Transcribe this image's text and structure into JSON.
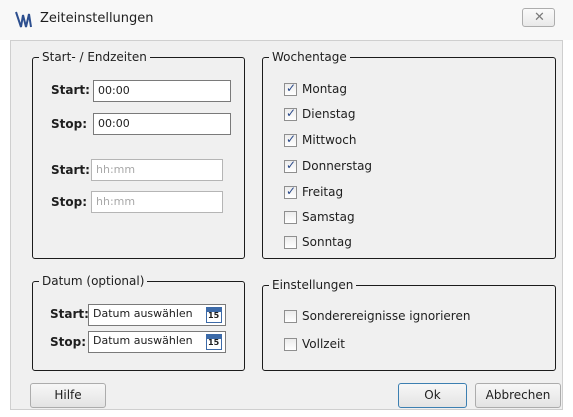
{
  "window": {
    "title": "Zeiteinstellungen",
    "close_glyph": "✕"
  },
  "times": {
    "legend": "Start- / Endzeiten",
    "rows": [
      {
        "label": "Start:",
        "value": "00:00",
        "placeholder": ""
      },
      {
        "label": "Stop:",
        "value": "00:00",
        "placeholder": ""
      },
      {
        "label": "Start:",
        "value": "",
        "placeholder": "hh:mm"
      },
      {
        "label": "Stop:",
        "value": "",
        "placeholder": "hh:mm"
      }
    ]
  },
  "weekdays": {
    "legend": "Wochentage",
    "days": [
      {
        "label": "Montag",
        "checked": true
      },
      {
        "label": "Dienstag",
        "checked": true
      },
      {
        "label": "Mittwoch",
        "checked": true
      },
      {
        "label": "Donnerstag",
        "checked": true
      },
      {
        "label": "Freitag",
        "checked": true
      },
      {
        "label": "Samstag",
        "checked": false
      },
      {
        "label": "Sonntag",
        "checked": false
      }
    ]
  },
  "date": {
    "legend": "Datum (optional)",
    "start_label": "Start:",
    "stop_label": "Stop:",
    "start_value": "Datum auswählen",
    "stop_value": "Datum auswählen",
    "calendar_day": "15"
  },
  "settings": {
    "legend": "Einstellungen",
    "options": [
      {
        "label": "Sonderereignisse ignorieren",
        "checked": false
      },
      {
        "label": "Vollzeit",
        "checked": false
      }
    ]
  },
  "buttons": {
    "help": "Hilfe",
    "ok": "Ok",
    "cancel": "Abbrechen"
  },
  "colors": {
    "accent": "#3c6aa8",
    "check": "#2b4a8a"
  },
  "icons": {
    "app": "app-logo-icon",
    "close": "close-icon",
    "calendar": "calendar-icon"
  }
}
